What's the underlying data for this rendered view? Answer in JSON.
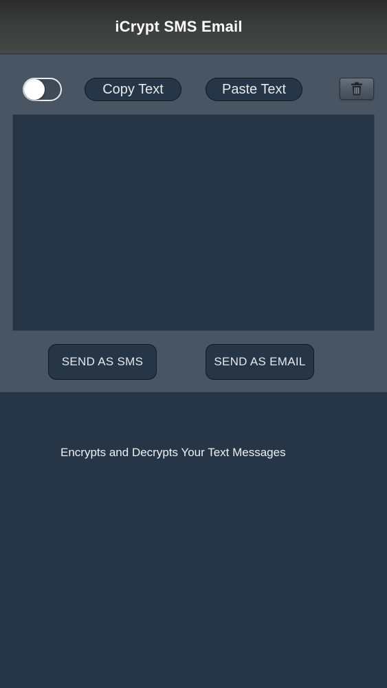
{
  "navbar": {
    "title": "iCrypt SMS Email"
  },
  "toolbar": {
    "toggle_on": false,
    "copy_label": "Copy Text",
    "paste_label": "Paste Text",
    "trash_icon": "trash-icon"
  },
  "editor": {
    "value": "",
    "placeholder": ""
  },
  "actions": {
    "send_sms_label": "SEND AS SMS",
    "send_email_label": "SEND AS EMAIL"
  },
  "footer": {
    "tagline": "Encrypts and Decrypts Your Text Messages"
  },
  "colors": {
    "background": "#263646",
    "panel": "#4a5563",
    "navbar": "#3c3d3d",
    "text": "#e6eaee"
  }
}
